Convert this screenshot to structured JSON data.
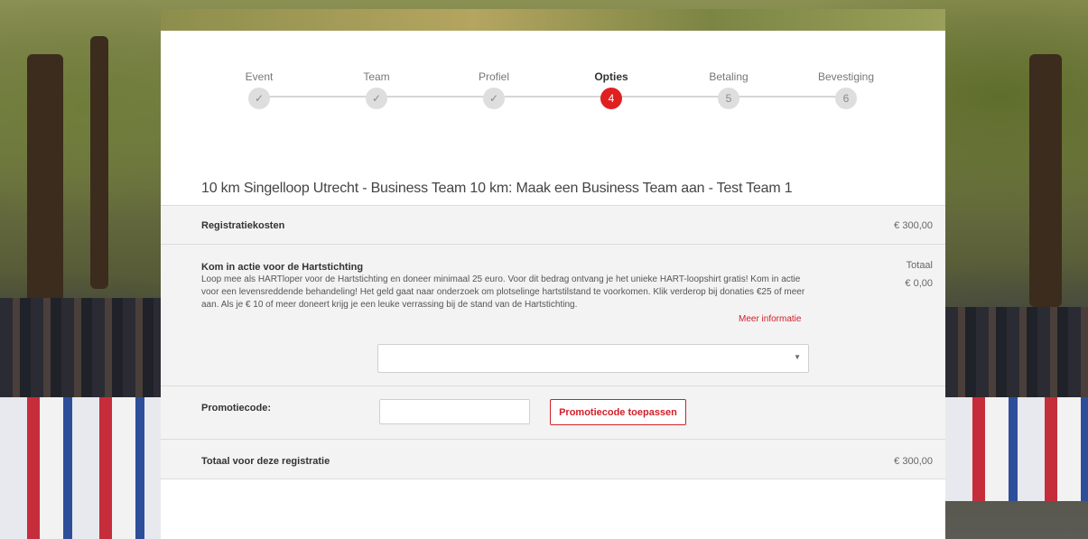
{
  "stepper": {
    "steps": [
      {
        "label": "Event",
        "marker": "✓"
      },
      {
        "label": "Team",
        "marker": "✓"
      },
      {
        "label": "Profiel",
        "marker": "✓"
      },
      {
        "label": "Opties",
        "marker": "4"
      },
      {
        "label": "Betaling",
        "marker": "5"
      },
      {
        "label": "Bevestiging",
        "marker": "6"
      }
    ],
    "active_index": 3
  },
  "registration": {
    "title": "10 km Singelloop Utrecht - Business Team 10 km: Maak een Business Team aan - Test Team 1"
  },
  "costs": {
    "label": "Registratiekosten",
    "value": "€ 300,00"
  },
  "donation": {
    "heading": "Kom in actie voor de Hartstichting",
    "description": "Loop mee als HARTloper voor de Hartstichting en doneer minimaal 25 euro. Voor dit bedrag ontvang je het unieke HART-loopshirt gratis! Kom in actie voor een levensreddende behandeling! Het geld gaat naar onderzoek om plotselinge hartstilstand te voorkomen. Klik verderop bij donaties €25 of meer aan. Als je € 10 of meer doneert krijg je een leuke verrassing bij de stand van de Hartstichting.",
    "more_info": "Meer informatie",
    "total_label": "Totaal",
    "total_value": "€ 0,00",
    "select_value": "",
    "select_arrow": "▼"
  },
  "promo": {
    "label": "Promotiecode:",
    "input_value": "",
    "button": "Promotiecode toepassen"
  },
  "summary": {
    "label": "Totaal voor deze registratie",
    "value": "€ 300,00"
  },
  "colors": {
    "accent": "#e02020",
    "link": "#d0202a"
  }
}
